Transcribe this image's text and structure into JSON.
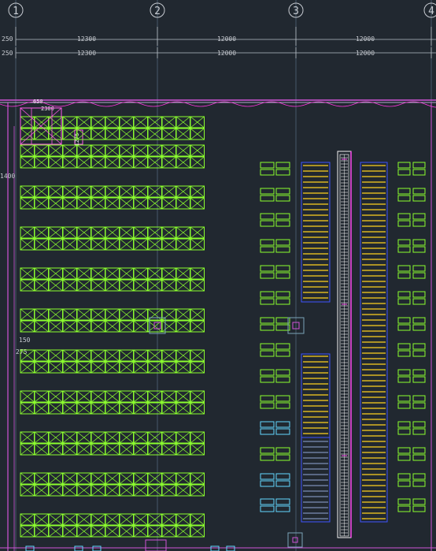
{
  "grid_axes": [
    "1",
    "2",
    "3",
    "4"
  ],
  "dimension_rows": [
    {
      "left_value": "250",
      "spans": [
        "12300",
        "12000",
        "12000"
      ]
    },
    {
      "left_value": "250",
      "spans": [
        "12300",
        "12000",
        "12000"
      ]
    }
  ],
  "side_labels": {
    "left_top_value": "650",
    "left_top_width": "2300",
    "left_mid_value": "1400",
    "left_small_value": "150",
    "left_small_value_2": "275",
    "top_box_value": "1275"
  },
  "colors": {
    "background": "#212830",
    "rack_green": "#8cff2e",
    "conveyor_yellow": "#ffd21f",
    "blue_line": "#3f53ff",
    "magenta": "#ff4bf1",
    "cyan_box": "#62d7ff",
    "white": "#f2f2f2",
    "grid_line": "#3b4854"
  }
}
